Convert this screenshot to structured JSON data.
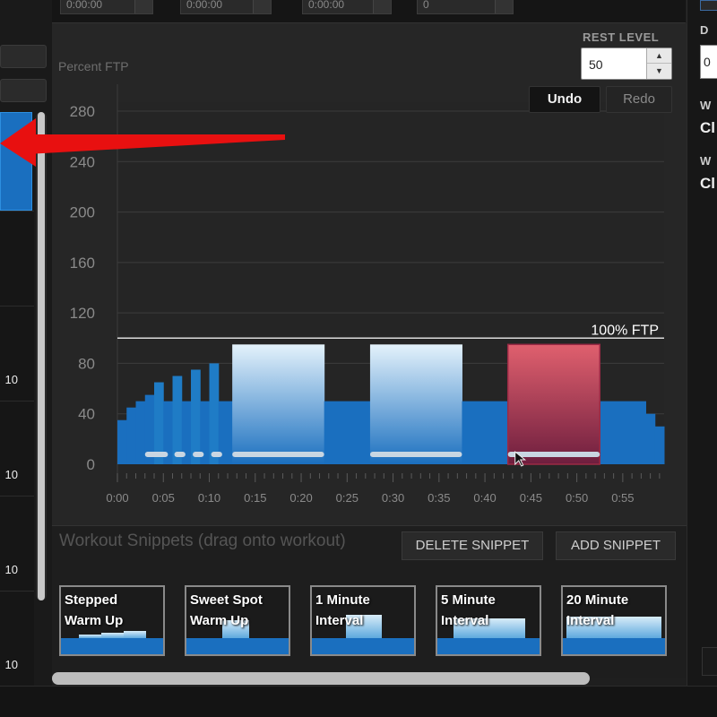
{
  "top_fields": [
    {
      "value": "0:00:00"
    },
    {
      "value": "0:00:00"
    },
    {
      "value": "0:00:00"
    },
    {
      "value": "0"
    }
  ],
  "rest_level": {
    "label": "REST LEVEL",
    "value": "50"
  },
  "history": {
    "undo_label": "Undo",
    "redo_label": "Redo"
  },
  "y_axis_label": "Percent FTP",
  "ftp_line_label": "100% FTP",
  "left_list": {
    "values": [
      "10",
      "10",
      "10",
      "10"
    ]
  },
  "snippets_panel": {
    "title": "Workout Snippets (drag onto workout)",
    "delete_label": "DELETE SNIPPET",
    "add_label": "ADD SNIPPET",
    "items": [
      {
        "line1": "Stepped",
        "line2": "Warm Up"
      },
      {
        "line1": "Sweet Spot",
        "line2": "Warm Up"
      },
      {
        "line1": "1 Minute",
        "line2": "Interval"
      },
      {
        "line1": "5 Minute",
        "line2": "Interval"
      },
      {
        "line1": "20 Minute",
        "line2": "Interval"
      }
    ]
  },
  "right_panel": {
    "label_top": "D",
    "field_value": "0",
    "label_w1": "W",
    "value_c1": "Cl",
    "label_w2": "W",
    "value_c2": "Cl"
  },
  "colors": {
    "rest_blue": "#1a6fbf",
    "interval_light": "#cfe6f6",
    "selected_red": "#b8334f",
    "arrow_red": "#e81010"
  },
  "chart_data": {
    "type": "area",
    "title": "",
    "ylabel": "Percent FTP",
    "xlabel": "",
    "ylim": [
      0,
      280
    ],
    "xlim": [
      0,
      59.5
    ],
    "y_ticks": [
      0,
      40,
      80,
      120,
      160,
      200,
      240,
      280
    ],
    "x_tick_labels": [
      "0:00",
      "0:05",
      "0:10",
      "0:15",
      "0:20",
      "0:25",
      "0:30",
      "0:35",
      "0:40",
      "0:45",
      "0:50",
      "0:55"
    ],
    "x_tick_values": [
      0,
      5,
      10,
      15,
      20,
      25,
      30,
      35,
      40,
      45,
      50,
      55
    ],
    "reference_line": {
      "y": 100,
      "label": "100% FTP"
    },
    "grid": true,
    "segments": [
      {
        "start": 0,
        "end": 1,
        "value": 35,
        "kind": "rest"
      },
      {
        "start": 1,
        "end": 2,
        "value": 45,
        "kind": "rest"
      },
      {
        "start": 2,
        "end": 3,
        "value": 50,
        "kind": "rest"
      },
      {
        "start": 3,
        "end": 4,
        "value": 55,
        "kind": "rest"
      },
      {
        "start": 4,
        "end": 5,
        "value": 65,
        "kind": "interval"
      },
      {
        "start": 5,
        "end": 6,
        "value": 50,
        "kind": "rest"
      },
      {
        "start": 6,
        "end": 7,
        "value": 70,
        "kind": "interval"
      },
      {
        "start": 7,
        "end": 8,
        "value": 50,
        "kind": "rest"
      },
      {
        "start": 8,
        "end": 9,
        "value": 75,
        "kind": "interval"
      },
      {
        "start": 9,
        "end": 10,
        "value": 50,
        "kind": "rest"
      },
      {
        "start": 10,
        "end": 11,
        "value": 80,
        "kind": "interval"
      },
      {
        "start": 11,
        "end": 12.5,
        "value": 50,
        "kind": "rest"
      },
      {
        "start": 12.5,
        "end": 22.5,
        "value": 95,
        "kind": "interval"
      },
      {
        "start": 22.5,
        "end": 27.5,
        "value": 50,
        "kind": "rest"
      },
      {
        "start": 27.5,
        "end": 37.5,
        "value": 95,
        "kind": "interval"
      },
      {
        "start": 37.5,
        "end": 42.5,
        "value": 50,
        "kind": "rest"
      },
      {
        "start": 42.5,
        "end": 52.5,
        "value": 95,
        "kind": "selected"
      },
      {
        "start": 52.5,
        "end": 57.5,
        "value": 50,
        "kind": "rest"
      },
      {
        "start": 57.5,
        "end": 58.5,
        "value": 40,
        "kind": "rest"
      },
      {
        "start": 58.5,
        "end": 59.5,
        "value": 30,
        "kind": "rest"
      }
    ],
    "cadence_marks": [
      {
        "start": 3,
        "end": 5.5
      },
      {
        "start": 6.2,
        "end": 7.4
      },
      {
        "start": 8.2,
        "end": 9.4
      },
      {
        "start": 10.2,
        "end": 11.4
      },
      {
        "start": 12.5,
        "end": 22.5
      },
      {
        "start": 27.5,
        "end": 37.5
      },
      {
        "start": 42.5,
        "end": 52.5
      }
    ]
  }
}
